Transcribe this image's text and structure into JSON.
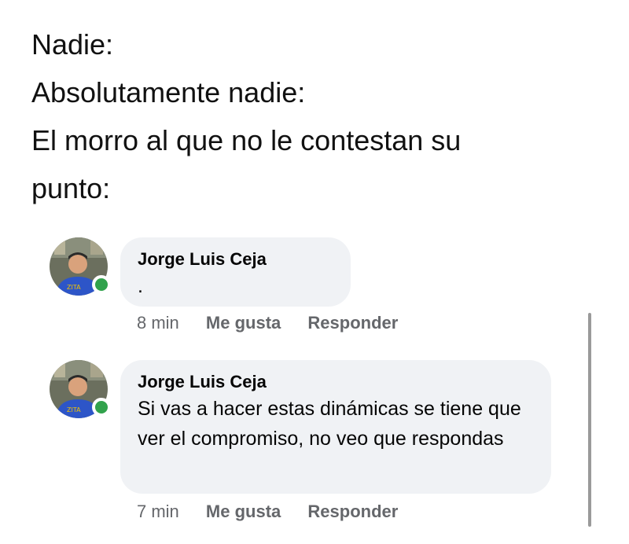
{
  "caption": {
    "line1": "Nadie:",
    "line2": "Absolutamente nadie:",
    "line3": "El morro al que no le contestan su",
    "line4": "punto:"
  },
  "comments": [
    {
      "author": "Jorge Luis Ceja",
      "text": ".",
      "time": "8 min",
      "like_label": "Me gusta",
      "reply_label": "Responder",
      "online": true
    },
    {
      "author": "Jorge Luis Ceja",
      "text": "Si vas a hacer estas dinámicas se tiene que ver el compromiso, no veo que respondas",
      "time": "7 min",
      "like_label": "Me gusta",
      "reply_label": "Responder",
      "online": true
    }
  ],
  "colors": {
    "bubble": "#f0f2f5",
    "online": "#31a24c",
    "secondary_text": "#65676b"
  }
}
